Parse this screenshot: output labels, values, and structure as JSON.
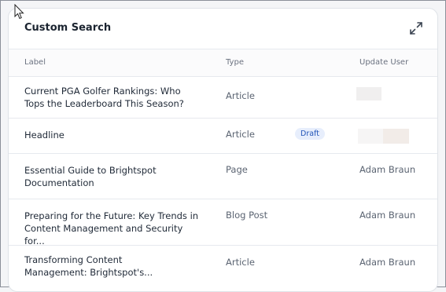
{
  "panel": {
    "title": "Custom Search",
    "expand_icon": "expand-icon"
  },
  "table": {
    "headers": {
      "label": "Label",
      "type": "Type",
      "update_user": "Update User"
    },
    "rows": [
      {
        "label_line1": "Current PGA Golfer Rankings: Who",
        "label_line2": "Tops the Leaderboard This Season?",
        "type": "Article",
        "badge": "",
        "update_user": ""
      },
      {
        "label_line1": "Headline",
        "label_line2": "",
        "type": "Article",
        "badge": "Draft",
        "update_user": ""
      },
      {
        "label_line1": "Essential Guide to Brightspot",
        "label_line2": "Documentation",
        "type": "Page",
        "badge": "",
        "update_user": "Adam Braun"
      },
      {
        "label_line1": "Preparing for the Future: Key Trends in",
        "label_line2": "Content Management and Security for...",
        "type": "Blog Post",
        "badge": "",
        "update_user": "Adam Braun"
      },
      {
        "label_line1": "Transforming Content",
        "label_line2": "Management: Brightspot's...",
        "type": "Article",
        "badge": "",
        "update_user": "Adam Braun"
      }
    ]
  },
  "colors": {
    "badge_text": "#2355b8",
    "badge_bg": "#e7eefc"
  }
}
